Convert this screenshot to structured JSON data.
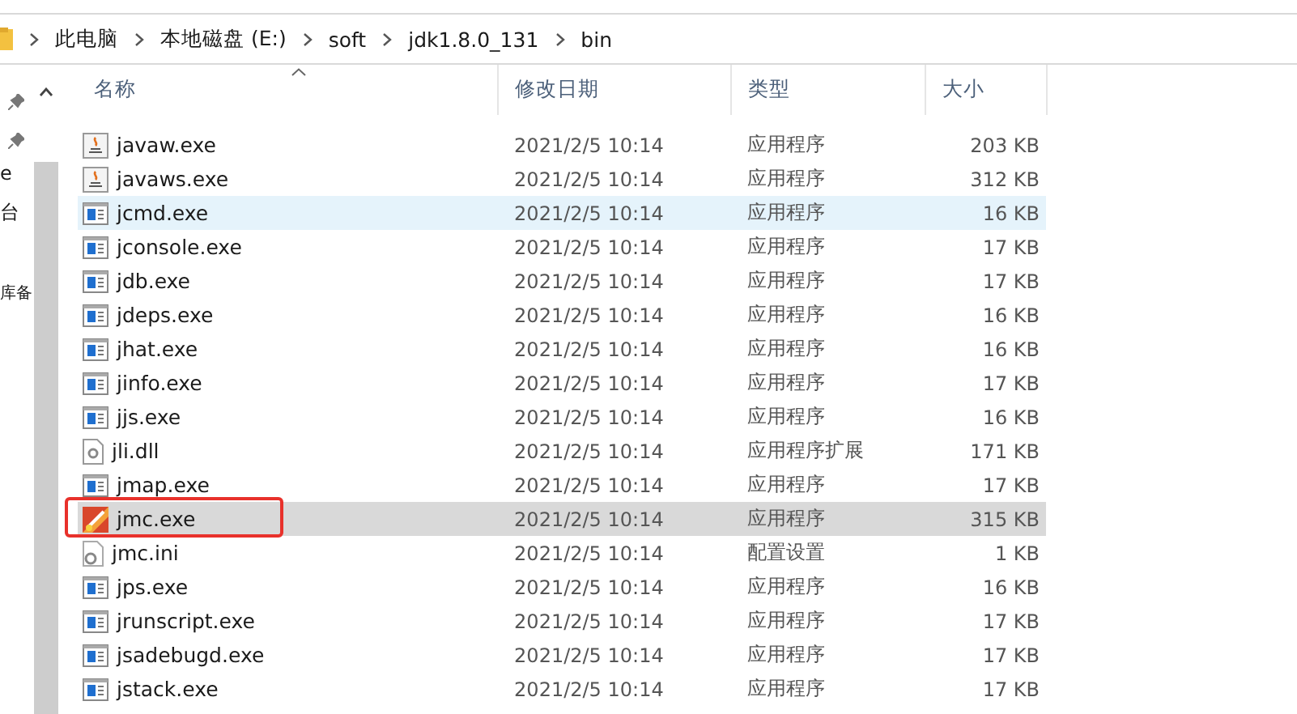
{
  "address_bar": {
    "crumbs": [
      "此电脑",
      "本地磁盘 (E:)",
      "soft",
      "jdk1.8.0_131",
      "bin"
    ]
  },
  "nav_pane": {
    "items": [
      "e",
      "台",
      "库备"
    ]
  },
  "columns": [
    "名称",
    "修改日期",
    "类型",
    "大小"
  ],
  "rows": [
    {
      "name": "javaw.exe",
      "kind": "java",
      "date": "2021/2/5 10:14",
      "type": "应用程序",
      "size": "203 KB",
      "hovered": false,
      "selected": false,
      "highlighted": false
    },
    {
      "name": "javaws.exe",
      "kind": "java",
      "date": "2021/2/5 10:14",
      "type": "应用程序",
      "size": "312 KB",
      "hovered": false,
      "selected": false,
      "highlighted": false
    },
    {
      "name": "jcmd.exe",
      "kind": "app",
      "date": "2021/2/5 10:14",
      "type": "应用程序",
      "size": "16 KB",
      "hovered": true,
      "selected": false,
      "highlighted": false
    },
    {
      "name": "jconsole.exe",
      "kind": "app",
      "date": "2021/2/5 10:14",
      "type": "应用程序",
      "size": "17 KB",
      "hovered": false,
      "selected": false,
      "highlighted": false
    },
    {
      "name": "jdb.exe",
      "kind": "app",
      "date": "2021/2/5 10:14",
      "type": "应用程序",
      "size": "17 KB",
      "hovered": false,
      "selected": false,
      "highlighted": false
    },
    {
      "name": "jdeps.exe",
      "kind": "app",
      "date": "2021/2/5 10:14",
      "type": "应用程序",
      "size": "16 KB",
      "hovered": false,
      "selected": false,
      "highlighted": false
    },
    {
      "name": "jhat.exe",
      "kind": "app",
      "date": "2021/2/5 10:14",
      "type": "应用程序",
      "size": "16 KB",
      "hovered": false,
      "selected": false,
      "highlighted": false
    },
    {
      "name": "jinfo.exe",
      "kind": "app",
      "date": "2021/2/5 10:14",
      "type": "应用程序",
      "size": "17 KB",
      "hovered": false,
      "selected": false,
      "highlighted": false
    },
    {
      "name": "jjs.exe",
      "kind": "app",
      "date": "2021/2/5 10:14",
      "type": "应用程序",
      "size": "16 KB",
      "hovered": false,
      "selected": false,
      "highlighted": false
    },
    {
      "name": "jli.dll",
      "kind": "dll",
      "date": "2021/2/5 10:14",
      "type": "应用程序扩展",
      "size": "171 KB",
      "hovered": false,
      "selected": false,
      "highlighted": false
    },
    {
      "name": "jmap.exe",
      "kind": "app",
      "date": "2021/2/5 10:14",
      "type": "应用程序",
      "size": "17 KB",
      "hovered": false,
      "selected": false,
      "highlighted": false
    },
    {
      "name": "jmc.exe",
      "kind": "jmc",
      "date": "2021/2/5 10:14",
      "type": "应用程序",
      "size": "315 KB",
      "hovered": false,
      "selected": true,
      "highlighted": true
    },
    {
      "name": "jmc.ini",
      "kind": "ini",
      "date": "2021/2/5 10:14",
      "type": "配置设置",
      "size": "1 KB",
      "hovered": false,
      "selected": false,
      "highlighted": false
    },
    {
      "name": "jps.exe",
      "kind": "app",
      "date": "2021/2/5 10:14",
      "type": "应用程序",
      "size": "16 KB",
      "hovered": false,
      "selected": false,
      "highlighted": false
    },
    {
      "name": "jrunscript.exe",
      "kind": "app",
      "date": "2021/2/5 10:14",
      "type": "应用程序",
      "size": "17 KB",
      "hovered": false,
      "selected": false,
      "highlighted": false
    },
    {
      "name": "jsadebugd.exe",
      "kind": "app",
      "date": "2021/2/5 10:14",
      "type": "应用程序",
      "size": "17 KB",
      "hovered": false,
      "selected": false,
      "highlighted": false
    },
    {
      "name": "jstack.exe",
      "kind": "app",
      "date": "2021/2/5 10:14",
      "type": "应用程序",
      "size": "17 KB",
      "hovered": false,
      "selected": false,
      "highlighted": false
    }
  ]
}
